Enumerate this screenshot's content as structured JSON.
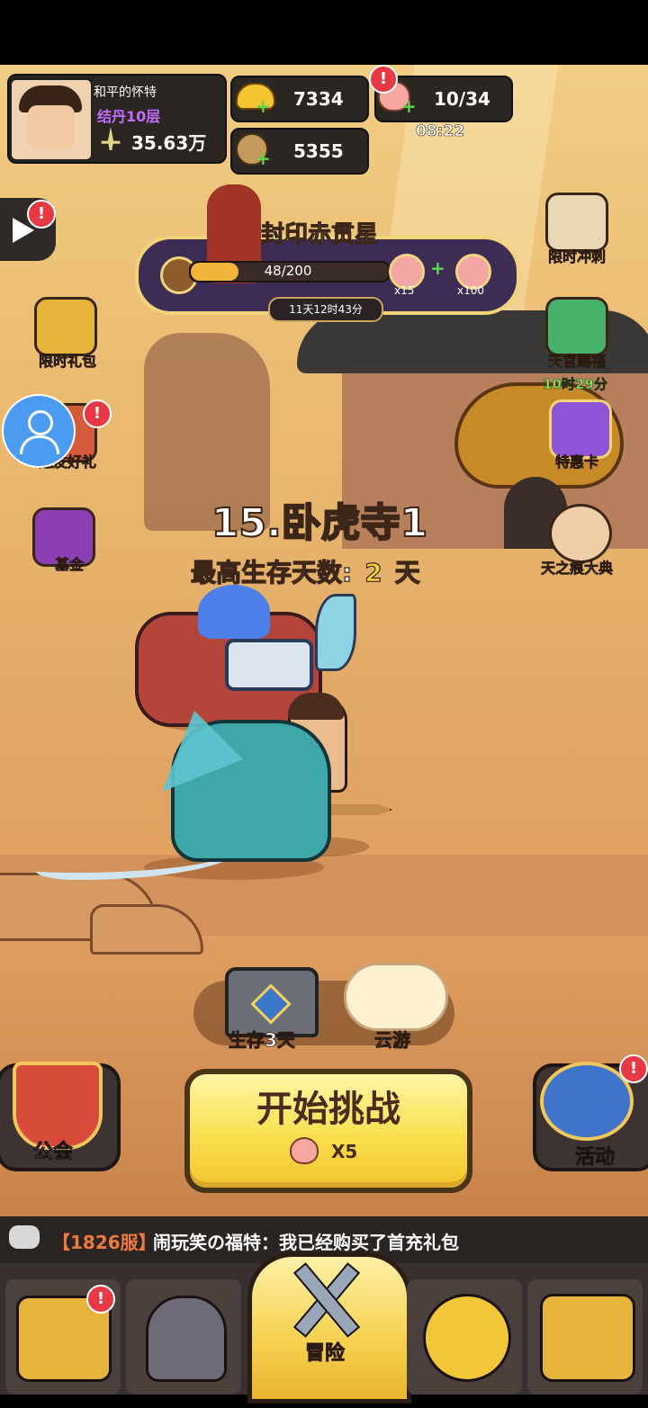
{
  "player": {
    "name": "和平的怀特",
    "realm": "结丹10层",
    "power": "35.63万"
  },
  "resources": {
    "gold": "7334",
    "copper": "5355",
    "stamina": "10/34",
    "stamina_timer": "08:22"
  },
  "event": {
    "title": "封印赤贯星",
    "progress_text": "48/200",
    "progress_fraction": 0.24,
    "countdown": "11天12时43分",
    "reward1_count": "x15",
    "reward2_count": "x100"
  },
  "left_menu": {
    "gift_label": "限时礼包",
    "friends_label": "邀友好礼",
    "fund_label": "基金"
  },
  "right_menu": {
    "sprint_label": "限时冲刺",
    "blessing_label": "天官赐福",
    "blessing_timer": "10时29分",
    "card_label": "特惠卡",
    "codex_label": "天之痕大典"
  },
  "stage": {
    "title": "15.卧虎寺1",
    "survive_label": "最高生存天数:",
    "survive_days": "2",
    "survive_unit": "天"
  },
  "bottom": {
    "chest_label": "生存3天",
    "cloud_label": "云游",
    "start_label": "开始挑战",
    "start_cost": "X5",
    "guild_label": "公会",
    "activity_label": "活动"
  },
  "chat": {
    "server": "【1826服】",
    "message": "闹玩笑の福特：我已经购买了首充礼包"
  },
  "nav": {
    "active_label": "冒险"
  },
  "badges": {
    "mark": "!"
  },
  "icons": [
    "play-icon",
    "gold-ingot-icon",
    "copper-coin-icon",
    "peach-icon",
    "shield-icon",
    "user-icon",
    "chest-icon",
    "cloud-icon",
    "chat-icon",
    "crossed-swords-icon",
    "helmet-icon",
    "upgrade-arrow-icon",
    "treasure-chest-icon"
  ],
  "colors": {
    "accent": "#f6d234",
    "alert": "#e63944",
    "purple": "#c46bff",
    "green": "#8ef061"
  }
}
